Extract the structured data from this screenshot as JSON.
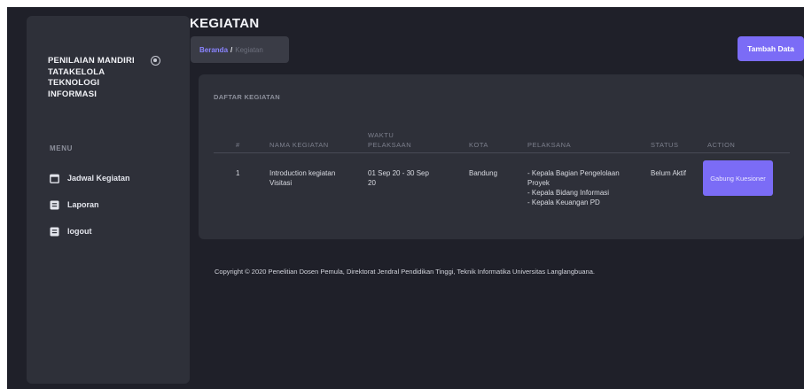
{
  "sidebar": {
    "brand": "PENILAIAN MANDIRI TATAKELOLA TEKNOLOGI INFORMASI",
    "menu_heading": "MENU",
    "items": [
      {
        "label": "Jadwal Kegiatan",
        "icon": "calendar-icon"
      },
      {
        "label": "Laporan",
        "icon": "document-icon"
      },
      {
        "label": "logout",
        "icon": "document-icon"
      }
    ]
  },
  "header": {
    "title": "KEGIATAN",
    "breadcrumb": {
      "home": "Beranda",
      "separator": "/",
      "current": "Kegiatan"
    },
    "add_button": "Tambah Data"
  },
  "card": {
    "title": "DAFTAR KEGIATAN",
    "columns": [
      "#",
      "NAMA KEGIATAN",
      "WAKTU PELAKSAAN",
      "KOTA",
      "PELAKSANA",
      "STATUS",
      "ACTION"
    ],
    "rows": [
      {
        "no": "1",
        "nama": "Introduction kegiatan Visitasi",
        "waktu": "01 Sep 20 - 30 Sep 20",
        "kota": "Bandung",
        "pelaksana": [
          "- Kepala Bagian Pengelolaan Proyek",
          "- Kepala Bidang Informasi",
          "- Kepala Keuangan PD"
        ],
        "status": "Belum Aktif",
        "action": "Gabung Kuesioner"
      }
    ]
  },
  "footer": {
    "copyright": "Copyright © 2020 Penelitian Dosen Pemula, Direktorat Jendral Pendidikan Tinggi, Teknik Informatika Universitas Langlangbuana."
  },
  "colors": {
    "background": "#1f2029",
    "panel": "#2e3039",
    "accent": "#7b6cf6",
    "breadcrumb_link": "#8a84ff"
  }
}
